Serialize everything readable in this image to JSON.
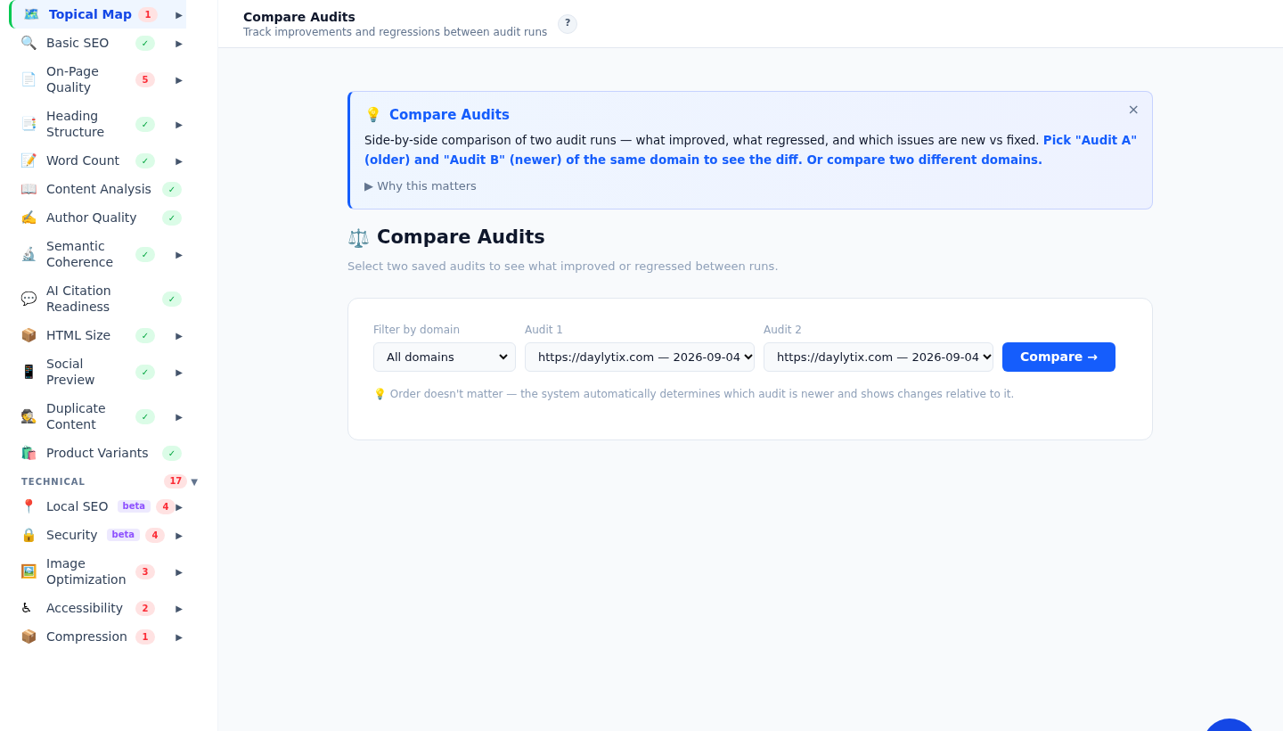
{
  "sidebar": {
    "items": [
      {
        "icon": "🗺️",
        "label": "Topical Map",
        "badge": {
          "kind": "count",
          "text": "1"
        },
        "arrow": "▶",
        "selected": true
      },
      {
        "icon": "🔍",
        "label": "Basic SEO",
        "badge": {
          "kind": "ok",
          "text": "✓"
        },
        "arrow": "▶",
        "selected": false
      },
      {
        "icon": "📄",
        "label": "On-Page Quality",
        "badge": {
          "kind": "count",
          "text": "5"
        },
        "arrow": "▶",
        "selected": false
      },
      {
        "icon": "📑",
        "label": "Heading Structure",
        "badge": {
          "kind": "ok",
          "text": "✓"
        },
        "arrow": "▶",
        "selected": false
      },
      {
        "icon": "📝",
        "label": "Word Count",
        "badge": {
          "kind": "ok",
          "text": "✓"
        },
        "arrow": "▶",
        "selected": false
      },
      {
        "icon": "📖",
        "label": "Content Analysis",
        "badge": {
          "kind": "ok",
          "text": "✓"
        },
        "selected": false
      },
      {
        "icon": "✍️",
        "label": "Author Quality",
        "badge": {
          "kind": "ok",
          "text": "✓"
        },
        "selected": false
      },
      {
        "icon": "🔬",
        "label": "Semantic Coherence",
        "badge": {
          "kind": "ok",
          "text": "✓"
        },
        "arrow": "▶",
        "selected": false
      },
      {
        "icon": "💬",
        "label": "AI Citation Readiness",
        "badge": {
          "kind": "ok",
          "text": "✓"
        },
        "selected": false
      },
      {
        "icon": "📦",
        "label": "HTML Size",
        "badge": {
          "kind": "ok",
          "text": "✓"
        },
        "arrow": "▶",
        "selected": false
      },
      {
        "icon": "📱",
        "label": "Social Preview",
        "badge": {
          "kind": "ok",
          "text": "✓"
        },
        "arrow": "▶",
        "selected": false
      },
      {
        "icon": "🕵️",
        "label": "Duplicate Content",
        "badge": {
          "kind": "ok",
          "text": "✓"
        },
        "arrow": "▶",
        "selected": false
      },
      {
        "icon": "🛍️",
        "label": "Product Variants",
        "badge": {
          "kind": "ok",
          "text": "✓"
        },
        "selected": false
      }
    ],
    "section": {
      "title": "TECHNICAL",
      "count": "17",
      "arrow": "▼",
      "items": [
        {
          "icon": "📍",
          "label": "Local SEO",
          "beta": "beta",
          "badge": {
            "kind": "count",
            "text": "4"
          },
          "arrow": "▶",
          "selected": false
        },
        {
          "icon": "🔒",
          "label": "Security",
          "beta": "beta",
          "badge": {
            "kind": "count",
            "text": "4"
          },
          "arrow": "▶",
          "selected": false
        },
        {
          "icon": "🖼️",
          "label": "Image Optimization",
          "badge": {
            "kind": "count",
            "text": "3"
          },
          "arrow": "▶",
          "selected": false
        },
        {
          "icon": "♿",
          "label": "Accessibility",
          "badge": {
            "kind": "count",
            "text": "2"
          },
          "arrow": "▶",
          "selected": false
        },
        {
          "icon": "📦",
          "label": "Compression",
          "badge": {
            "kind": "count",
            "text": "1"
          },
          "arrow": "▶",
          "selected": false
        }
      ]
    }
  },
  "header": {
    "title": "Compare Audits",
    "subtitle": "Track improvements and regressions between audit runs",
    "help": "?"
  },
  "info": {
    "icon": "💡",
    "title": "Compare Audits",
    "close": "×",
    "text": "Side-by-side comparison of two audit runs — what improved, what regressed, and which issues are new vs fixed. **Pick \"Audit A\" (older) and \"Audit B\" (newer) of the same domain to see the diff. Or compare two different domains.**",
    "more": "▶ Why this matters"
  },
  "page": {
    "icon": "⚖️",
    "title": "Compare Audits",
    "subtitle": "Select two saved audits to see what improved or regressed between runs."
  },
  "form": {
    "fields": [
      {
        "label": "Filter by domain",
        "value": "All domains"
      },
      {
        "label": "Audit 1",
        "value": "https://daylytix.com — 2026-09-04"
      },
      {
        "label": "Audit 2",
        "value": "https://daylytix.com — 2026-09-04"
      }
    ],
    "button": "Compare →",
    "hint": "💡 Order doesn't matter — the system automatically determines which audit is newer and shows changes relative to it."
  }
}
